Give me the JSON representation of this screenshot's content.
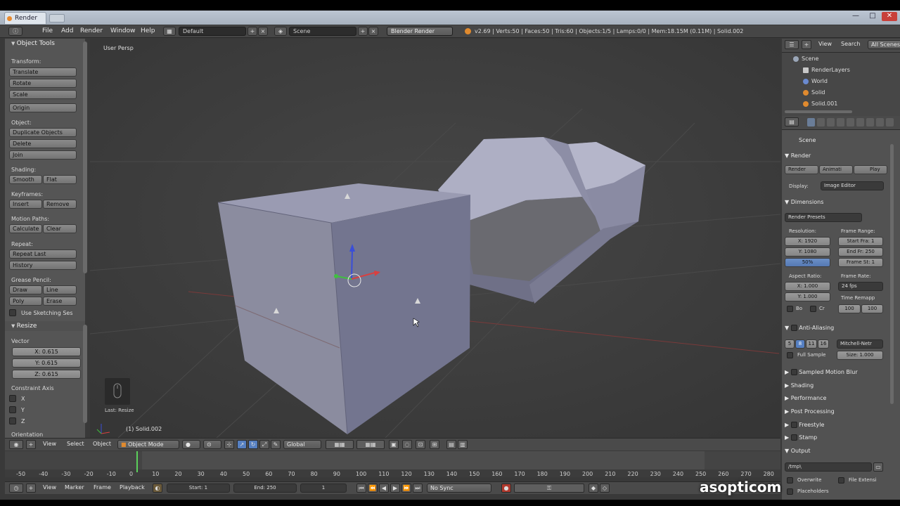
{
  "titlebar": {
    "tab_title": "Render",
    "minimize": "—",
    "maximize": "□",
    "close": "✕"
  },
  "menubar": {
    "items": [
      "File",
      "Add",
      "Render",
      "Window",
      "Help"
    ],
    "layout": "Default",
    "scene": "Scene",
    "engine": "Blender Render",
    "stats": "v2.69 | Verts:50 | Faces:50 | Tris:60 | Objects:1/5 | Lamps:0/0 | Mem:18.15M (0.11M) | Solid.002"
  },
  "tools": {
    "title": "Object Tools",
    "transform_label": "Transform:",
    "translate": "Translate",
    "rotate": "Rotate",
    "scale": "Scale",
    "origin": "Origin",
    "object_label": "Object:",
    "duplicate": "Duplicate Objects",
    "delete": "Delete",
    "join": "Join",
    "shading_label": "Shading:",
    "smooth": "Smooth",
    "flat": "Flat",
    "keyframes_label": "Keyframes:",
    "insert": "Insert",
    "remove": "Remove",
    "motion_label": "Motion Paths:",
    "calculate": "Calculate",
    "clear": "Clear",
    "repeat_label": "Repeat:",
    "repeat_last": "Repeat Last",
    "history": "History",
    "grease_label": "Grease Pencil:",
    "draw": "Draw",
    "line": "Line",
    "poly": "Poly",
    "erase": "Erase",
    "use_sketching": "Use Sketching Ses",
    "resize_title": "Resize",
    "vector_label": "Vector",
    "vx": "X: 0.615",
    "vy": "Y: 0.615",
    "vz": "Z: 0.615",
    "constraint_label": "Constraint Axis",
    "cx": "X",
    "cy": "Y",
    "cz": "Z",
    "orientation_label": "Orientation"
  },
  "viewport": {
    "view_label": "User Persp",
    "object_label": "(1) Solid.002",
    "last_op": "Last: Resize"
  },
  "vphead": {
    "view": "View",
    "select": "Select",
    "object": "Object",
    "mode": "Object Mode",
    "orientation": "Global"
  },
  "timeline": {
    "numbers": [
      "-50",
      "-40",
      "-30",
      "-20",
      "-10",
      "0",
      "10",
      "20",
      "30",
      "40",
      "50",
      "60",
      "70",
      "80",
      "90",
      "100",
      "110",
      "120",
      "130",
      "140",
      "150",
      "160",
      "170",
      "180",
      "190",
      "200",
      "210",
      "220",
      "230",
      "240",
      "250",
      "260",
      "270",
      "280"
    ],
    "view": "View",
    "marker": "Marker",
    "frame": "Frame",
    "playback": "Playback",
    "start": "Start: 1",
    "end": "End: 250",
    "current": "1",
    "sync": "No Sync"
  },
  "outliner": {
    "view": "View",
    "search": "Search",
    "filter": "All Scenes",
    "rows": [
      "Scene",
      "RenderLayers",
      "World",
      "Solid",
      "Solid.001"
    ]
  },
  "props": {
    "context": "Scene",
    "render_panel": "Render",
    "render_btn": "Render",
    "anim_btn": "Animati",
    "play_btn": "Play",
    "display_label": "Display:",
    "display_value": "Image Editor",
    "dimensions_panel": "Dimensions",
    "presets": "Render Presets",
    "resolution_label": "Resolution:",
    "res_x": "X: 1920",
    "res_y": "Y: 1080",
    "res_pct": "50%",
    "frame_range_label": "Frame Range:",
    "start_frame": "Start Fra: 1",
    "end_frame": "End Fr: 250",
    "frame_step": "Frame St: 1",
    "aspect_label": "Aspect Ratio:",
    "asp_x": "X: 1.000",
    "asp_y": "Y: 1.000",
    "framerate_label": "Frame Rate:",
    "fps": "24 fps",
    "time_remap_label": "Time Remapp",
    "remap_old": "100",
    "remap_new": "100",
    "bo": "Bo",
    "cr": "Cr",
    "aa_panel": "Anti-Aliasing",
    "aa_samples": [
      "5",
      "8",
      "11",
      "16"
    ],
    "aa_filter": "Mitchell-Netr",
    "full_sample": "Full Sample",
    "aa_size": "Size: 1.000",
    "motion_blur": "Sampled Motion Blur",
    "shading": "Shading",
    "performance": "Performance",
    "post": "Post Processing",
    "freestyle": "Freestyle",
    "stamp": "Stamp",
    "output": "Output",
    "output_path": "/tmp\\",
    "overwrite": "Overwrite",
    "file_ext": "File Extensi",
    "placeholders": "Placeholders"
  },
  "watermark": "asopticom",
  "colors": {
    "accent": "#5680c2",
    "mesh": "#8d8ea6",
    "viewport_bg": "#3d3d3d"
  }
}
